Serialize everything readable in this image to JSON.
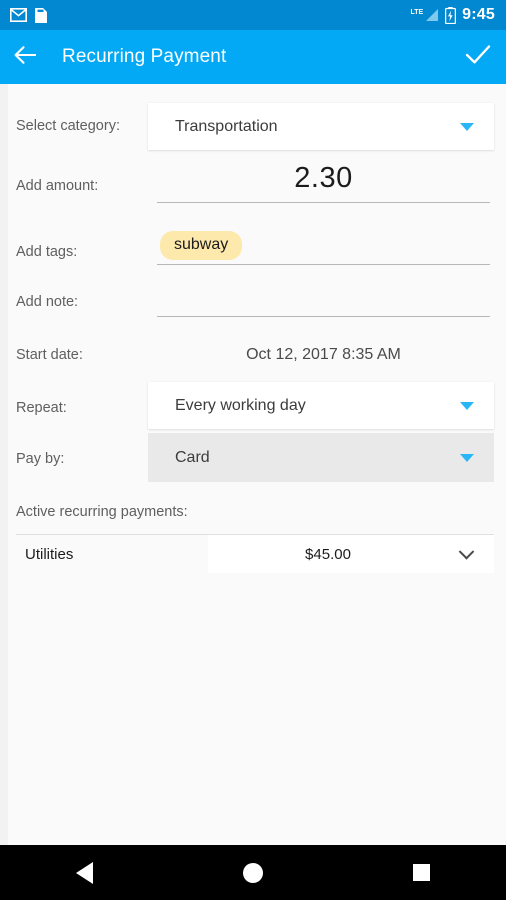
{
  "status_bar": {
    "icons": [
      "gmail-icon",
      "sim-card-icon"
    ],
    "network": "LTE",
    "battery": "battery-charging-icon",
    "time": "9:45",
    "background_color": "#0288D1"
  },
  "app_bar": {
    "back_icon": "arrow-left-icon",
    "title": "Recurring Payment",
    "confirm_icon": "check-icon",
    "background_color": "#03A9F4"
  },
  "form": {
    "category": {
      "label": "Select category:",
      "value": "Transportation",
      "dropdown_icon": "caret-down-icon"
    },
    "amount": {
      "label": "Add amount:",
      "value": "2.30"
    },
    "tags": {
      "label": "Add tags:",
      "chips": [
        "subway"
      ],
      "chip_color": "#FCE9AB"
    },
    "note": {
      "label": "Add note:",
      "value": ""
    },
    "start_date": {
      "label": "Start date:",
      "value": "Oct 12, 2017 8:35 AM"
    },
    "repeat": {
      "label": "Repeat:",
      "value": "Every working day",
      "dropdown_icon": "caret-down-icon"
    },
    "pay_by": {
      "label": "Pay by:",
      "value": "Card",
      "dropdown_icon": "caret-down-icon",
      "state": "pressed"
    }
  },
  "active_payments": {
    "label": "Active recurring payments:",
    "columns": [
      "name",
      "amount"
    ],
    "rows": [
      {
        "name": "Utilities",
        "amount": "$45.00",
        "expand_icon": "chevron-down-icon"
      }
    ]
  },
  "nav_bar": {
    "back": "back-triangle-icon",
    "home": "home-circle-icon",
    "recents": "recents-square-icon"
  }
}
